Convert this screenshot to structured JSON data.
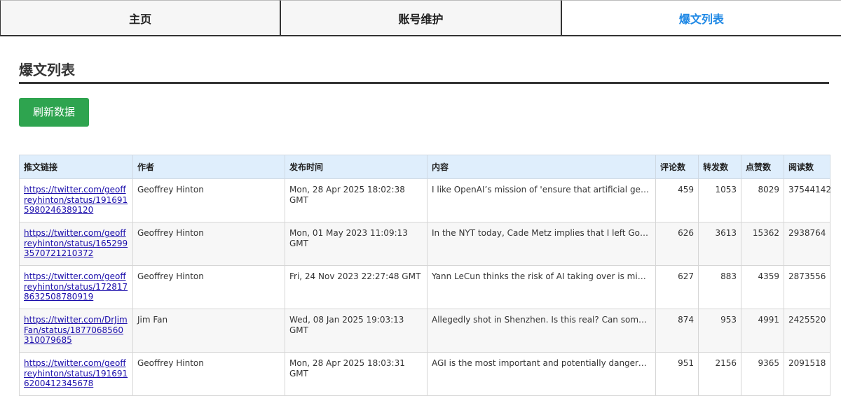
{
  "tabs": [
    {
      "label": "主页",
      "active": false
    },
    {
      "label": "账号维护",
      "active": false
    },
    {
      "label": "爆文列表",
      "active": true
    }
  ],
  "page": {
    "title": "爆文列表",
    "refresh_label": "刷新数据"
  },
  "table": {
    "headers": {
      "link": "推文链接",
      "author": "作者",
      "time": "发布时间",
      "content": "内容",
      "comments": "评论数",
      "reposts": "转发数",
      "likes": "点赞数",
      "views": "阅读数"
    },
    "rows": [
      {
        "link": "https://twitter.com/geoffreyhinton/status/1916915980246389120",
        "author": "Geoffrey Hinton",
        "time": "Mon, 28 Apr 2025 18:02:38 GMT",
        "content": "I like OpenAI’s mission of 'ensure that artificial general intelligence benefits all of humanity'",
        "comments": "459",
        "reposts": "1053",
        "likes": "8029",
        "views": "37544142"
      },
      {
        "link": "https://twitter.com/geoffreyhinton/status/1652993570721210372",
        "author": "Geoffrey Hinton",
        "time": "Mon, 01 May 2023 11:09:13 GMT",
        "content": "In the NYT today, Cade Metz implies that I left Google so that I could criticize Google.",
        "comments": "626",
        "reposts": "3613",
        "likes": "15362",
        "views": "2938764"
      },
      {
        "link": "https://twitter.com/geoffreyhinton/status/1728178632508780919",
        "author": "Geoffrey Hinton",
        "time": "Fri, 24 Nov 2023 22:27:48 GMT",
        "content": "Yann LeCun thinks the risk of AI taking over is miniscule. This means he puts a big weight on his own opinion.",
        "comments": "627",
        "reposts": "883",
        "likes": "4359",
        "views": "2873556"
      },
      {
        "link": "https://twitter.com/DrJimFan/status/1877068560310079685",
        "author": "Jim Fan",
        "time": "Wed, 08 Jan 2025 19:03:13 GMT",
        "content": "Allegedly shot in Shenzhen. Is this real? Can someone verify?",
        "comments": "874",
        "reposts": "953",
        "likes": "4991",
        "views": "2425520"
      },
      {
        "link": "https://twitter.com/geoffreyhinton/status/1916916200412345678",
        "author": "Geoffrey Hinton",
        "time": "Mon, 28 Apr 2025 18:03:31 GMT",
        "content": "AGI is the most important and potentially dangerous technology of our time.",
        "comments": "951",
        "reposts": "2156",
        "likes": "9365",
        "views": "2091518"
      }
    ]
  }
}
